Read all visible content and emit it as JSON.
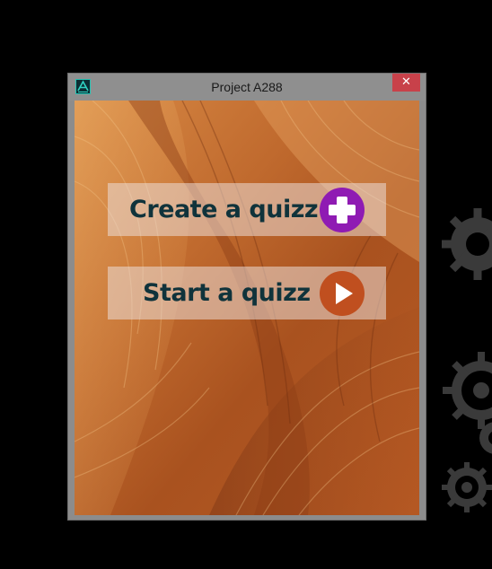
{
  "window": {
    "title": "Project A288",
    "close_label": "✕",
    "app_icon": "app-logo-icon"
  },
  "menu": {
    "create_label": "Create a quizz",
    "create_icon": "plus-circle-icon",
    "start_label": "Start a quizz",
    "start_icon": "play-circle-icon"
  },
  "colors": {
    "create_accent": "#8f1bb3",
    "start_accent": "#c04f1f",
    "label_text": "#10333b",
    "close_button": "#c8414a"
  },
  "background": {
    "description_icon": "canyon-sandstone-background",
    "gears": "gears-icon"
  }
}
